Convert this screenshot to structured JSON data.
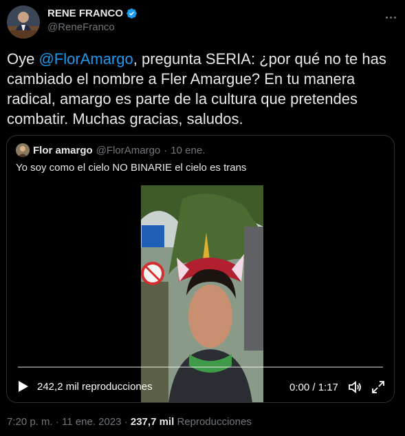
{
  "author": {
    "name": "RENE FRANCO",
    "handle": "@ReneFranco"
  },
  "tweet": {
    "intro": "Oye ",
    "mention": "@FlorAmargo",
    "body": ", pregunta SERIA: ¿por qué no te has cambiado el nombre a Fler Amargue? En tu manera radical, amargo es parte de la cultura que pretendes combatir. Muchas gracias, saludos."
  },
  "quote": {
    "name": "Flor amargo",
    "handle": "@FlorAmargo",
    "separator": "·",
    "date": "10 ene.",
    "text": "Yo soy como el cielo NO BINARIE el cielo es trans",
    "video": {
      "views": "242,2 mil reproducciones",
      "time": "0:00 / 1:17",
      "progress": 0
    }
  },
  "footer": {
    "time": "7:20 p. m.",
    "separator": "·",
    "date": "11 ene. 2023",
    "separator2": "·",
    "views_count": "237,7 mil",
    "views_label": "Reproducciones"
  },
  "colors": {
    "accent": "#1d9bf0",
    "background": "#000000",
    "text": "#e7e9ea",
    "muted": "#71767b",
    "border": "#2f3336"
  },
  "icons": [
    "verified-badge-icon",
    "more-options-icon",
    "play-icon",
    "volume-icon",
    "fullscreen-icon"
  ]
}
